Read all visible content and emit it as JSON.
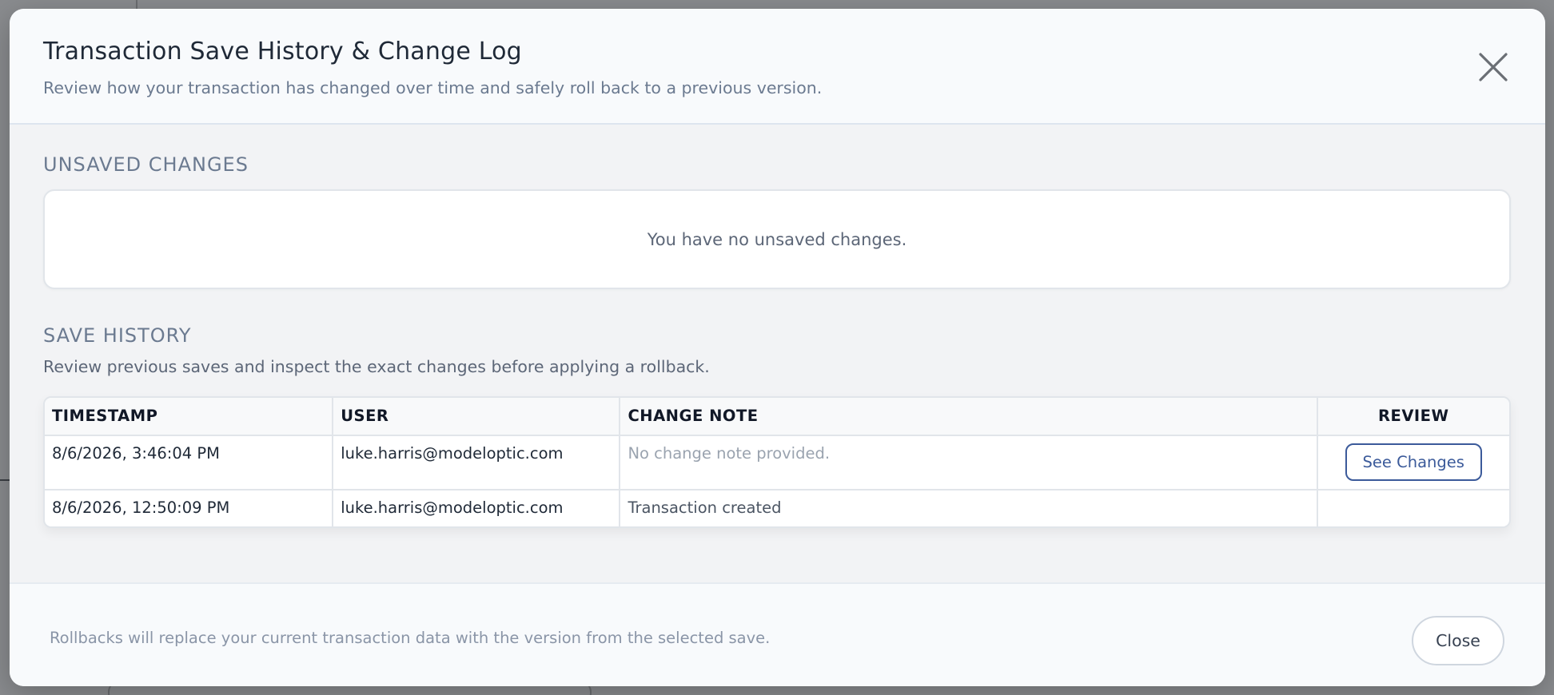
{
  "modal": {
    "title": "Transaction Save History & Change Log",
    "subtitle": "Review how your transaction has changed over time and safely roll back to a previous version."
  },
  "unsaved": {
    "heading": "UNSAVED CHANGES",
    "empty_message": "You have no unsaved changes."
  },
  "history": {
    "heading": "SAVE HISTORY",
    "description": "Review previous saves and inspect the exact changes before applying a rollback.",
    "columns": [
      "TIMESTAMP",
      "USER",
      "CHANGE NOTE",
      "REVIEW"
    ],
    "rows": [
      {
        "timestamp": "8/6/2026, 3:46:04 PM",
        "user": "luke.harris@modeloptic.com",
        "note": "No change note provided.",
        "review_label": "See Changes"
      },
      {
        "timestamp": "8/6/2026, 12:50:09 PM",
        "user": "luke.harris@modeloptic.com",
        "note": "Transaction created",
        "review_label": ""
      }
    ]
  },
  "footer": {
    "note": "Rollbacks will replace your current transaction data with the version from the selected save.",
    "close_label": "Close"
  },
  "colors": {
    "accent": "#3b5a9a",
    "muted_text": "#6b7a90"
  },
  "icons": {
    "close": "close-icon"
  }
}
